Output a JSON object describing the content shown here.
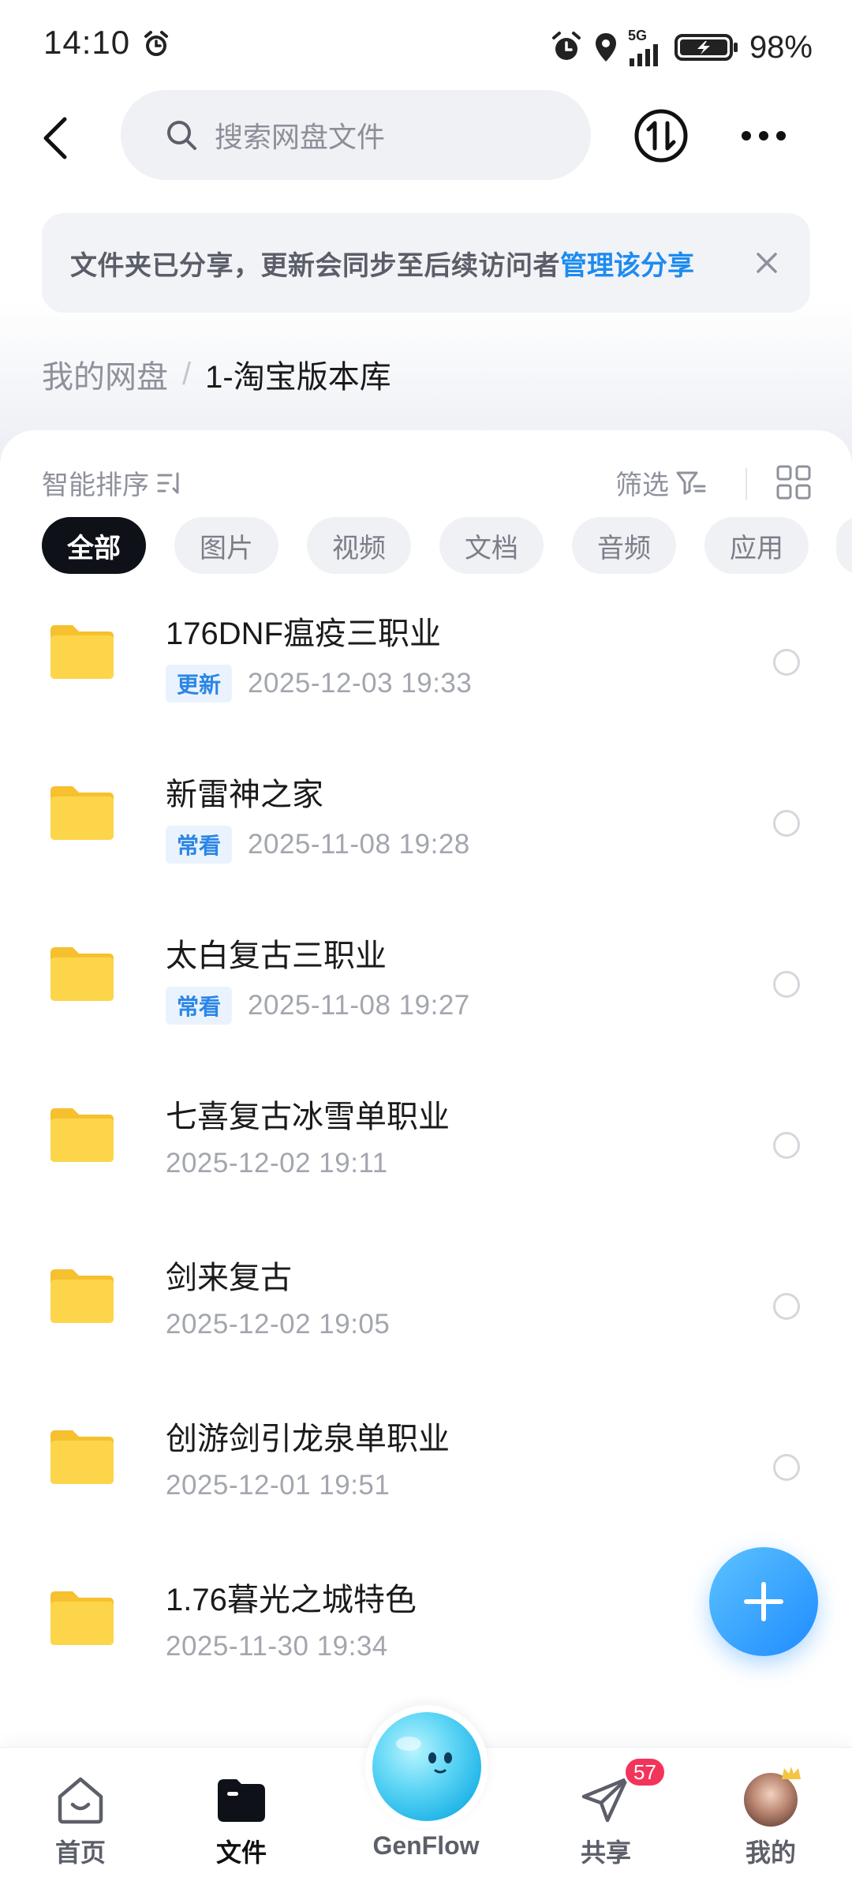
{
  "status_bar": {
    "time": "14:10",
    "network": "5G",
    "battery": "98%"
  },
  "search": {
    "placeholder": "搜索网盘文件"
  },
  "banner": {
    "text": "文件夹已分享，更新会同步至后续访问者",
    "link": "管理该分享"
  },
  "breadcrumb": {
    "root": "我的网盘",
    "separator": "/",
    "current": "1-淘宝版本库"
  },
  "toolbar": {
    "sort_label": "智能排序",
    "filter_label": "筛选"
  },
  "chips": [
    {
      "label": "全部",
      "active": true
    },
    {
      "label": "图片",
      "active": false
    },
    {
      "label": "视频",
      "active": false
    },
    {
      "label": "文档",
      "active": false
    },
    {
      "label": "音频",
      "active": false
    },
    {
      "label": "应用",
      "active": false
    }
  ],
  "files": [
    {
      "name": "176DNF瘟疫三职业",
      "tag": "更新",
      "date": "2025-12-03  19:33"
    },
    {
      "name": "新雷神之家",
      "tag": "常看",
      "date": "2025-11-08  19:28"
    },
    {
      "name": "太白复古三职业",
      "tag": "常看",
      "date": "2025-11-08  19:27"
    },
    {
      "name": "七喜复古冰雪单职业",
      "tag": "",
      "date": "2025-12-02  19:11"
    },
    {
      "name": "剑来复古",
      "tag": "",
      "date": "2025-12-02  19:05"
    },
    {
      "name": "创游剑引龙泉单职业",
      "tag": "",
      "date": "2025-12-01  19:51"
    },
    {
      "name": "1.76暮光之城特色",
      "tag": "",
      "date": "2025-11-30  19:34"
    }
  ],
  "bottom_nav": {
    "home": "首页",
    "files": "文件",
    "genflow": "GenFlow",
    "share": "共享",
    "share_badge": "57",
    "mine": "我的"
  },
  "colors": {
    "accent": "#1c8bf0",
    "folder": "#fdd54a",
    "badge": "#f3345a",
    "chip_active": "#0f1118"
  }
}
